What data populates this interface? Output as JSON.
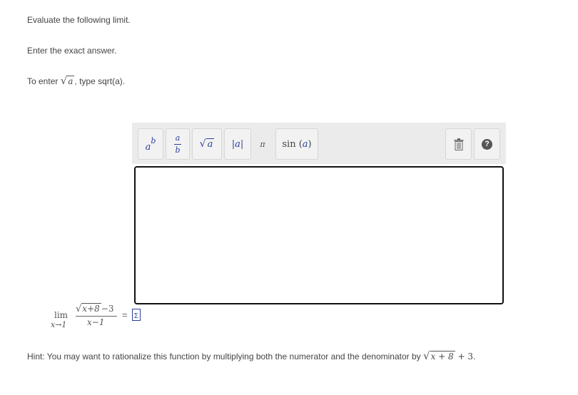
{
  "instructions": {
    "line1": "Evaluate the following limit.",
    "line2": "Enter the exact answer.",
    "line3_prefix": "To enter",
    "line3_arg": "a",
    "line3_suffix": ", type sqrt(a)."
  },
  "toolbar": {
    "power_base": "a",
    "power_exp": "b",
    "fraction_num": "a",
    "fraction_den": "b",
    "sqrt_arg": "a",
    "abs_label": "|a|",
    "pi_label": "π",
    "sin_label": "sin",
    "sin_arg": "a",
    "help_label": "?"
  },
  "editor": {
    "value": ""
  },
  "problem": {
    "lim_word": "lim",
    "lim_sub": "x→1",
    "num_radicand": "x+8",
    "num_tail": "−3",
    "denominator": "x−1",
    "equals": "=",
    "answer_marker": "Σ"
  },
  "hint": {
    "prefix": "Hint: You may want to rationalize this function by multiplying both the numerator and the denominator by",
    "radicand": "x + 8",
    "tail": " + 3",
    "end": "."
  }
}
